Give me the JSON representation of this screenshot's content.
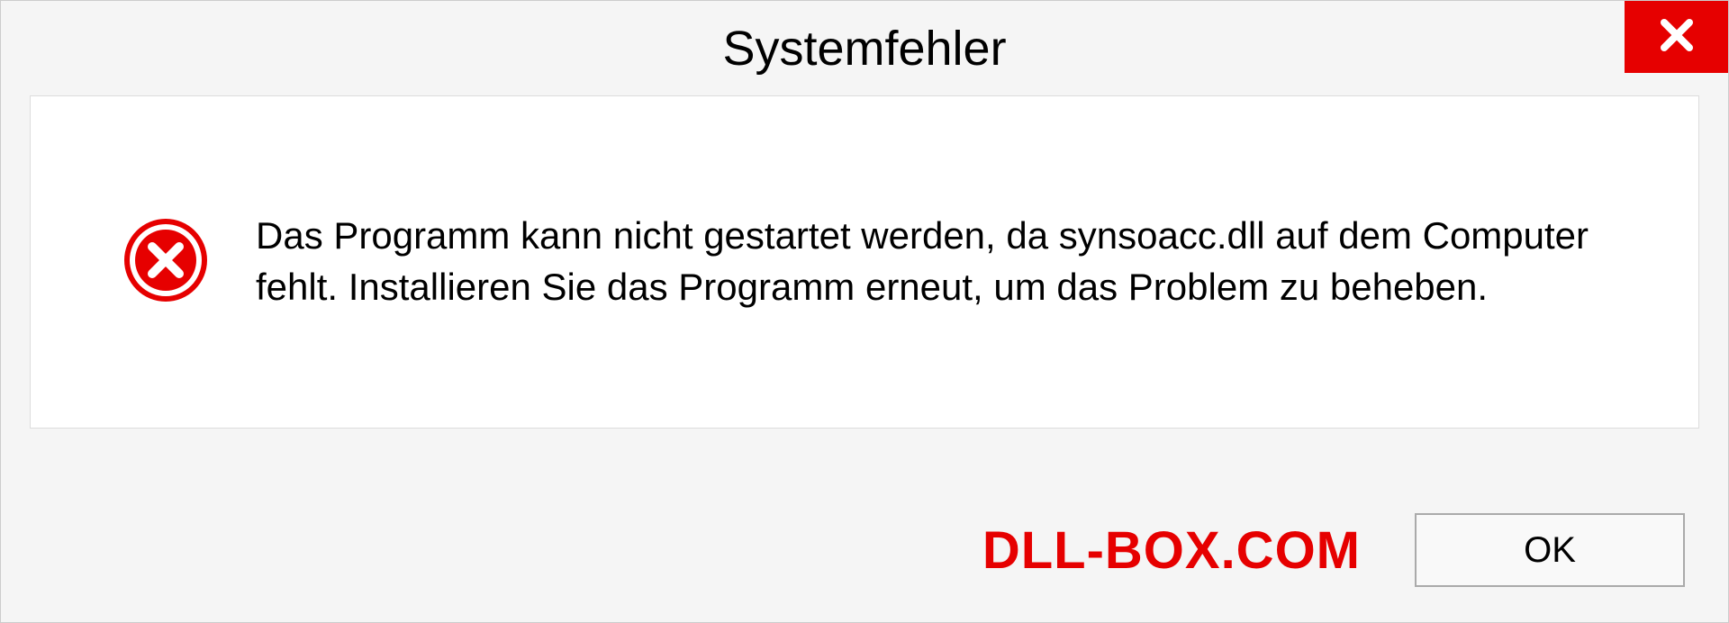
{
  "dialog": {
    "title": "Systemfehler",
    "message": "Das Programm kann nicht gestartet werden, da synsoacc.dll auf dem Computer fehlt. Installieren Sie das Programm erneut, um das Problem zu beheben.",
    "ok_label": "OK"
  },
  "watermark": "DLL-BOX.COM"
}
